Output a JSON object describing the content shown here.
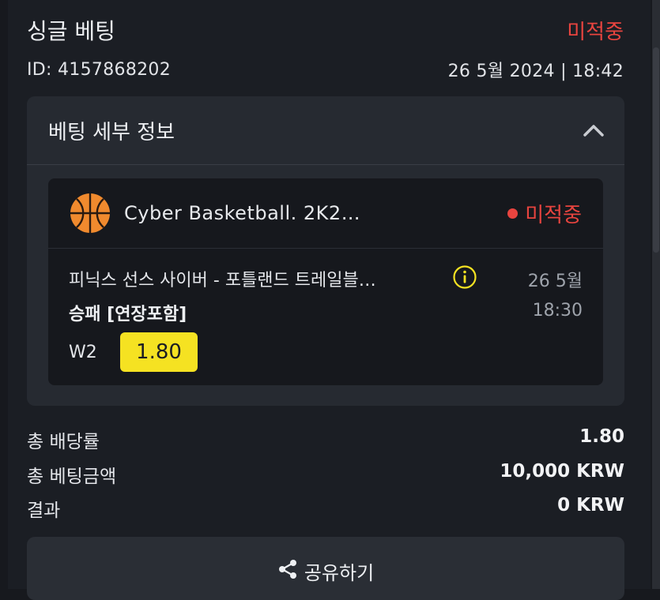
{
  "bet": {
    "title": "싱글 베팅",
    "status": "미적중",
    "id_label": "ID: 4157868202",
    "datetime": "26 5월 2024 | 18:42"
  },
  "details": {
    "title": "베팅 세부 정보",
    "event": {
      "sport": "Cyber Basketball. 2K2…",
      "status": "미적중",
      "match": "피닉스 선스 사이버 - 포틀랜드 트레일블…",
      "date": "26 5월",
      "time": "18:30",
      "market": "승패 [연장포함]",
      "pick": "W2",
      "odds": "1.80"
    }
  },
  "summary": {
    "total_odds_label": "총 배당률",
    "total_odds_value": "1.80",
    "total_stake_label": "총 베팅금액",
    "total_stake_value": "10,000 KRW",
    "result_label": "결과",
    "result_value": "0 KRW"
  },
  "share": {
    "label": "공유하기"
  },
  "colors": {
    "lost_red": "#e8443f",
    "odds_yellow": "#f5e222"
  }
}
